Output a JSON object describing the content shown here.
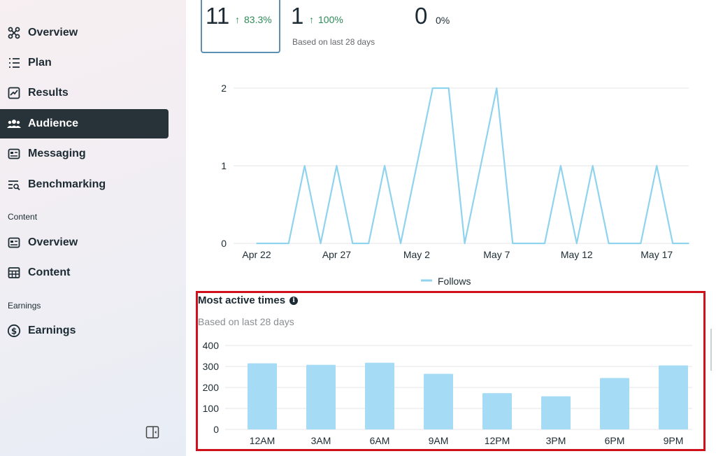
{
  "sidebar": {
    "items": [
      {
        "label": "Overview",
        "icon": "network-icon"
      },
      {
        "label": "Plan",
        "icon": "list-icon"
      },
      {
        "label": "Results",
        "icon": "trend-chart-icon"
      },
      {
        "label": "Audience",
        "icon": "people-icon",
        "active": true
      },
      {
        "label": "Messaging",
        "icon": "message-card-icon"
      },
      {
        "label": "Benchmarking",
        "icon": "benchmark-search-icon"
      }
    ],
    "content_label": "Content",
    "content_items": [
      {
        "label": "Overview",
        "icon": "card-icon"
      },
      {
        "label": "Content",
        "icon": "table-grid-icon"
      }
    ],
    "earnings_label": "Earnings",
    "earnings_items": [
      {
        "label": "Earnings",
        "icon": "dollar-circle-icon"
      }
    ]
  },
  "stats": {
    "card1": {
      "value": "11",
      "change": "83.3%"
    },
    "card2": {
      "value": "1",
      "change": "100%",
      "sub": "Based on last 28 days"
    },
    "card3": {
      "value": "0",
      "change": "0%"
    }
  },
  "most_active": {
    "title": "Most active times",
    "subtitle": "Based on last 28 days"
  },
  "colors": {
    "line": "#8fd3ef",
    "bar": "#a6dbf6",
    "highlight": "#d0101a",
    "positive": "#2e8b57"
  },
  "chart_data": [
    {
      "type": "line",
      "x": [
        "Apr 22",
        "Apr 23",
        "Apr 24",
        "Apr 25",
        "Apr 26",
        "Apr 27",
        "Apr 28",
        "Apr 29",
        "Apr 30",
        "May 1",
        "May 2",
        "May 3",
        "May 4",
        "May 5",
        "May 6",
        "May 7",
        "May 8",
        "May 9",
        "May 10",
        "May 11",
        "May 12",
        "May 13",
        "May 14",
        "May 15",
        "May 16",
        "May 17",
        "May 18",
        "May 19"
      ],
      "series": [
        {
          "name": "Follows",
          "values": [
            0,
            0,
            0,
            1,
            0,
            1,
            0,
            0,
            1,
            0,
            1,
            2,
            2,
            0,
            1,
            2,
            0,
            0,
            0,
            1,
            0,
            1,
            0,
            0,
            0,
            1,
            0,
            0
          ]
        }
      ],
      "xticks": [
        "Apr 22",
        "Apr 27",
        "May 2",
        "May 7",
        "May 12",
        "May 17"
      ],
      "yticks": [
        0,
        1,
        2
      ],
      "ylim": [
        0,
        2
      ],
      "grid": true,
      "legend": "bottom"
    },
    {
      "type": "bar",
      "categories": [
        "12AM",
        "3AM",
        "6AM",
        "9AM",
        "12PM",
        "3PM",
        "6PM",
        "9PM"
      ],
      "values": [
        315,
        308,
        318,
        265,
        173,
        158,
        245,
        305
      ],
      "yticks": [
        0,
        100,
        200,
        300,
        400
      ],
      "ylim": [
        0,
        400
      ],
      "grid": true
    }
  ]
}
